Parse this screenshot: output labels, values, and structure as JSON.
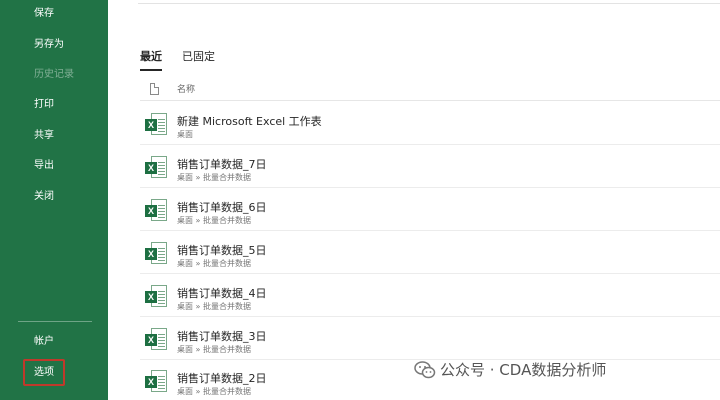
{
  "sidebar": {
    "items": [
      {
        "label": "保存",
        "enabled": true
      },
      {
        "label": "另存为",
        "enabled": true
      },
      {
        "label": "历史记录",
        "enabled": false
      },
      {
        "label": "打印",
        "enabled": true
      },
      {
        "label": "共享",
        "enabled": true
      },
      {
        "label": "导出",
        "enabled": true
      },
      {
        "label": "关闭",
        "enabled": true
      }
    ],
    "bottom_items": [
      {
        "label": "帐户"
      },
      {
        "label": "选项",
        "highlighted": true
      }
    ],
    "color": "#217346",
    "highlight_color": "#c0392b"
  },
  "tabs": {
    "recent": "最近",
    "pinned": "已固定",
    "active": "recent"
  },
  "list_header": {
    "name_column": "名称"
  },
  "files": [
    {
      "name": "新建 Microsoft Excel 工作表",
      "path": "桌面"
    },
    {
      "name": "销售订单数据_7日",
      "path": "桌面 » 批量合并数据"
    },
    {
      "name": "销售订单数据_6日",
      "path": "桌面 » 批量合并数据"
    },
    {
      "name": "销售订单数据_5日",
      "path": "桌面 » 批量合并数据"
    },
    {
      "name": "销售订单数据_4日",
      "path": "桌面 » 批量合并数据"
    },
    {
      "name": "销售订单数据_3日",
      "path": "桌面 » 批量合并数据"
    },
    {
      "name": "销售订单数据_2日",
      "path": "桌面 » 批量合并数据"
    }
  ],
  "file_icon": {
    "badge": "X",
    "name": "excel-file-icon"
  },
  "watermark": {
    "text": "公众号 · CDA数据分析师"
  }
}
